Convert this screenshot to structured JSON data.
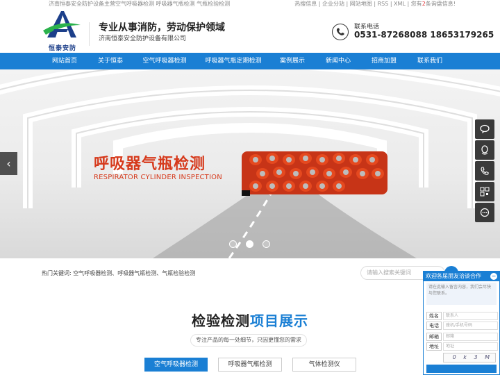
{
  "topbar": {
    "tagline": "济南恒泰安全防护设备主营空气呼吸器检测 呼吸器气瓶检测 气瓶检验检测",
    "links": "热搜信息 | 企业分站 | 网站地图 | RSS | XML |",
    "links_tail": "您有",
    "links_count": "2",
    "links_suffix": "条询盘信息!"
  },
  "header": {
    "logo_text": "恒泰安防",
    "slogan": "专业从事消防，劳动保护领域",
    "company": "济南恒泰安全防护设备有限公司",
    "phone_label": "联系电话",
    "phone_numbers": "0531-87268088  18653179265",
    "icons": {
      "phone": "phone-icon"
    }
  },
  "nav": {
    "items": [
      {
        "label": "网站首页"
      },
      {
        "label": "关于恒泰"
      },
      {
        "label": "空气呼吸器检测"
      },
      {
        "label": "呼吸器气瓶定期检测"
      },
      {
        "label": "案例展示"
      },
      {
        "label": "新闻中心"
      },
      {
        "label": "招商加盟"
      },
      {
        "label": "联系我们"
      }
    ]
  },
  "banner": {
    "title": "呼吸器气瓶检测",
    "subtitle": "RESPIRATOR CYLINDER INSPECTION",
    "prev_icon": "chevron-left-icon",
    "slide_count": 3,
    "active_slide": 2
  },
  "float_bar": {
    "icons": [
      "chat-icon",
      "qq-icon",
      "phone-icon",
      "qrcode-icon",
      "message-icon"
    ]
  },
  "keywords": {
    "label": "热门关键词:",
    "items": "空气呼吸器检测、呼吸器气瓶检测、气瓶检验检测"
  },
  "search": {
    "placeholder": "请输入搜索关键词"
  },
  "section": {
    "title_main": "检验检测",
    "title_highlight": "项目展示",
    "subtitle": "专注产品的每一处细节，只因更懂您的需求",
    "tabs": [
      {
        "label": "空气呼吸器检测",
        "active": true
      },
      {
        "label": "呼吸器气瓶检测",
        "active": false
      },
      {
        "label": "气体检测仪",
        "active": false
      }
    ]
  },
  "chat": {
    "title": "欢迎各届朋友洽谈合作",
    "message_placeholder": "请在此输入留言内容，我们会尽快与您联系。",
    "fields": [
      {
        "label": "姓名",
        "placeholder": "联系人"
      },
      {
        "label": "电话",
        "placeholder": "座机/手机号码"
      },
      {
        "label": "邮箱",
        "placeholder": "邮箱"
      },
      {
        "label": "地址",
        "placeholder": "地址"
      }
    ],
    "captcha": "0 k 3 M"
  },
  "colors": {
    "primary": "#1a7fd4",
    "accent_red": "#d63a1c",
    "dark": "#222222"
  }
}
